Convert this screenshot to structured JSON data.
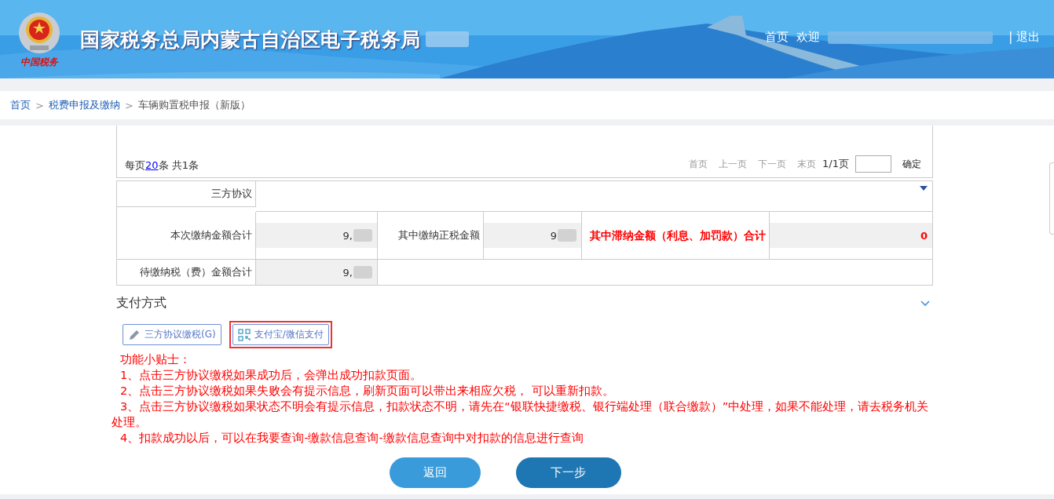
{
  "header": {
    "title": "国家税务总局内蒙古自治区电子税务局",
    "logo_caption": "中国税务",
    "nav": [
      {
        "kind": "link",
        "label": "首页"
      },
      {
        "kind": "text",
        "label": "欢迎"
      },
      {
        "kind": "redacted"
      },
      {
        "kind": "link",
        "label": "| 退出"
      }
    ]
  },
  "breadcrumb": [
    {
      "label": "首页",
      "link": true
    },
    {
      "separator": ">",
      "label": "税费申报及缴纳",
      "link": true
    },
    {
      "separator": ">",
      "label": "车辆购置税申报（新版）",
      "link": false
    }
  ],
  "pager": {
    "per_page_prefix": "每页",
    "per_page": "20",
    "per_page_suffix": "条 共1条",
    "links": [
      "首页",
      "上一页",
      "下一页",
      "末页"
    ],
    "page_info": "1/1页",
    "confirm": "确定"
  },
  "form": {
    "agreement_label": "三方协议",
    "rows": [
      [
        {
          "kind": "label",
          "text": "本次缴纳金额合计"
        },
        {
          "kind": "value",
          "text": "9,",
          "redacted": true
        },
        {
          "kind": "label",
          "text": "其中缴纳正税金额"
        },
        {
          "kind": "value",
          "text": "9",
          "redacted": true
        },
        {
          "kind": "warn-label",
          "text": "其中滞纳金额（利息、加罚款）合计"
        },
        {
          "kind": "warn-value",
          "text": "0",
          "redacted": false
        }
      ],
      [
        {
          "kind": "label",
          "text": "待缴纳税（费）金额合计"
        },
        {
          "kind": "value",
          "text": "9,",
          "redacted": true
        },
        {
          "kind": "empty"
        }
      ]
    ]
  },
  "payment": {
    "title": "支付方式",
    "methods": [
      {
        "kind": "pencil",
        "label": "三方协议缴税(G)",
        "selected": false
      },
      {
        "kind": "qr",
        "label": "支付宝/微信支付",
        "selected": true
      }
    ],
    "tips_title": "功能小贴士：",
    "tips": [
      "1、点击三方协议缴税如果成功后，会弹出成功扣款页面。",
      "2、点击三方协议缴税如果失败会有提示信息，刷新页面可以带出来相应欠税， 可以重新扣款。",
      "3、点击三方协议缴税如果状态不明会有提示信息，扣款状态不明，请先在“银联快捷缴税、银行端处理（联合缴款）”中处理，如果不能处理，请去税务机关处理。",
      "4、扣款成功以后，可以在我要查询-缴款信息查询-缴款信息查询中对扣款的信息进行查询"
    ]
  },
  "actions": [
    {
      "kind": "back",
      "label": "返回"
    },
    {
      "kind": "next",
      "label": "下一步"
    }
  ]
}
